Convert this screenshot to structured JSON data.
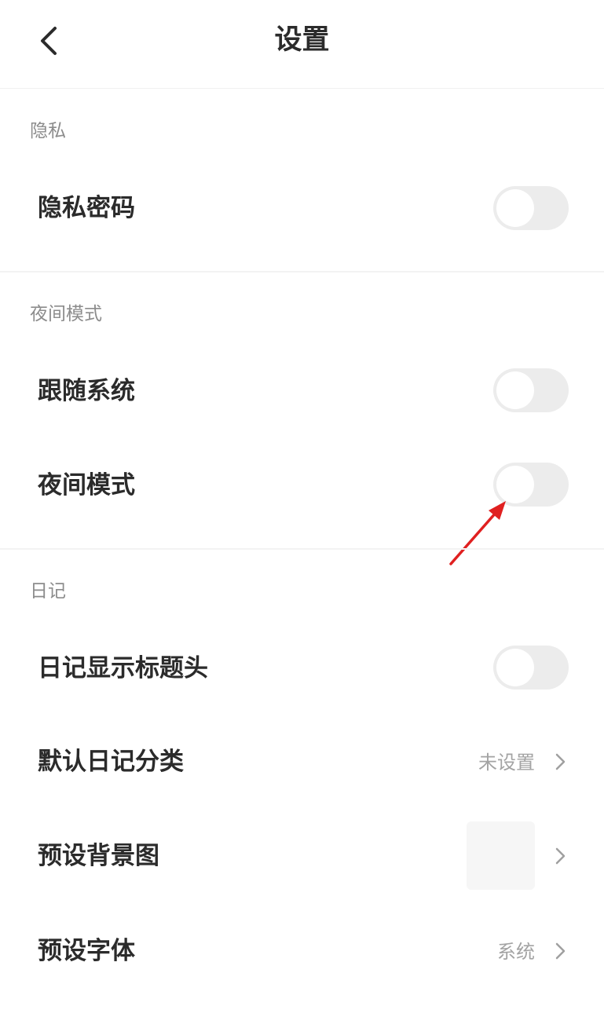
{
  "header": {
    "title": "设置",
    "back_icon": "chevron-left-icon"
  },
  "sections": {
    "privacy": {
      "title": "隐私",
      "privacy_password": {
        "label": "隐私密码",
        "enabled": false
      }
    },
    "night_mode": {
      "title": "夜间模式",
      "follow_system": {
        "label": "跟随系统",
        "enabled": false
      },
      "night_mode": {
        "label": "夜间模式",
        "enabled": false
      }
    },
    "diary": {
      "title": "日记",
      "show_title_header": {
        "label": "日记显示标题头",
        "enabled": false
      },
      "default_category": {
        "label": "默认日记分类",
        "value": "未设置"
      },
      "default_background": {
        "label": "预设背景图"
      },
      "default_font": {
        "label": "预设字体",
        "value": "系统"
      }
    }
  },
  "colors": {
    "toggle_off_track": "#ececec",
    "annotation_arrow": "#e02020"
  }
}
